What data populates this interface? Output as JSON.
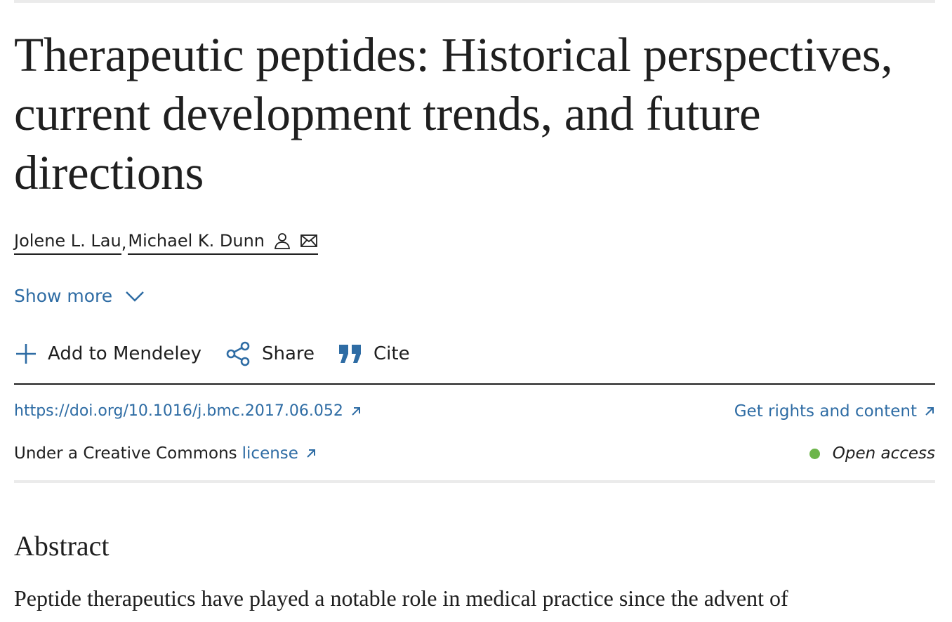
{
  "article": {
    "title": "Therapeutic peptides: Historical perspectives, current development trends, and future directions",
    "authors": [
      {
        "name": "Jolene L. Lau"
      },
      {
        "name": "Michael K. Dunn",
        "icons": [
          "person-icon",
          "mail-icon"
        ]
      }
    ],
    "author_separator": ",",
    "show_more_label": "Show more",
    "actions": {
      "mendeley_label": "Add to Mendeley",
      "share_label": "Share",
      "cite_label": "Cite"
    },
    "doi_link": "https://doi.org/10.1016/j.bmc.2017.06.052",
    "rights_link": "Get rights and content",
    "license_text": "Under a Creative Commons",
    "license_link": "license",
    "access_label": "Open access",
    "abstract_heading": "Abstract",
    "abstract_text": "Peptide therapeutics have played a notable role in medical practice since the advent of"
  },
  "colors": {
    "link": "#2e6ca4",
    "text": "#1f1f1f",
    "open_access_dot": "#6cb54a",
    "rule_light": "#ebebeb"
  }
}
